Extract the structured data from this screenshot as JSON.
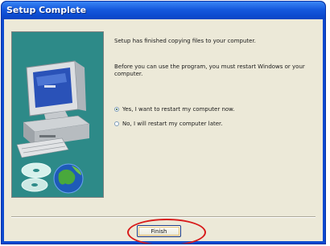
{
  "window": {
    "title": "Setup Complete"
  },
  "message": {
    "line1": "Setup has finished copying files to your computer.",
    "line2": "Before you can use the program, you must restart Windows or your computer."
  },
  "options": [
    {
      "label": "Yes, I want to restart my computer now.",
      "checked": true
    },
    {
      "label": "No, I will restart my computer later.",
      "checked": false
    }
  ],
  "buttons": {
    "finish_label": "Finish"
  },
  "colors": {
    "title_bar": "#1559dd",
    "client_bg": "#ece9d8",
    "art_bg": "#2d8a88",
    "highlight": "#d81b1b"
  }
}
